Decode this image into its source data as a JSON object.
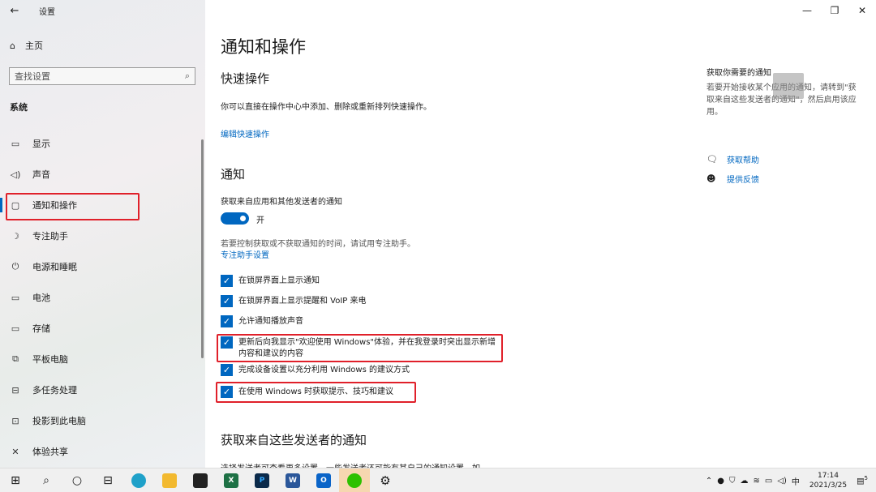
{
  "app": {
    "title": "设置",
    "back_icon": "back-arrow-icon"
  },
  "window_controls": {
    "minimize": "—",
    "maximize": "❐",
    "close": "✕"
  },
  "sidebar": {
    "home_label": "主页",
    "search_placeholder": "查找设置",
    "section": "系统",
    "items": [
      {
        "label": "显示",
        "icon": "display-icon"
      },
      {
        "label": "声音",
        "icon": "speaker-icon"
      },
      {
        "label": "通知和操作",
        "icon": "notification-icon",
        "active": true
      },
      {
        "label": "专注助手",
        "icon": "moon-icon"
      },
      {
        "label": "电源和睡眠",
        "icon": "power-icon"
      },
      {
        "label": "电池",
        "icon": "battery-icon"
      },
      {
        "label": "存储",
        "icon": "storage-icon"
      },
      {
        "label": "平板电脑",
        "icon": "tablet-icon"
      },
      {
        "label": "多任务处理",
        "icon": "multitask-icon"
      },
      {
        "label": "投影到此电脑",
        "icon": "project-icon"
      },
      {
        "label": "体验共享",
        "icon": "share-icon"
      }
    ]
  },
  "main": {
    "title": "通知和操作",
    "quick": {
      "heading": "快速操作",
      "desc": "你可以直接在操作中心中添加、删除或重新排列快速操作。",
      "link": "编辑快速操作"
    },
    "notify": {
      "heading": "通知",
      "toggle_label": "获取来自应用和其他发送者的通知",
      "toggle_state": "开",
      "focus_desc": "若要控制获取或不获取通知的时间，请试用专注助手。",
      "focus_link": "专注助手设置",
      "checkboxes": [
        "在锁屏界面上显示通知",
        "在锁屏界面上显示提醒和 VoIP 来电",
        "允许通知播放声音",
        "更新后向我显示\"欢迎使用 Windows\"体验，并在我登录时突出显示新增内容和建议的内容",
        "完成设备设置以充分利用 Windows 的建议方式",
        "在使用 Windows 时获取提示、技巧和建议"
      ]
    },
    "senders": {
      "heading": "获取来自这些发送者的通知",
      "partial": "选择发送者可查看更多设置。一些发送者还可能有其自己的通知设置。如"
    }
  },
  "right": {
    "title": "获取你需要的通知",
    "desc": "若要开始接收某个应用的通知，请转到\"获取来自这些发送者的通知\"，然后启用该应用。",
    "help": "获取帮助",
    "feedback": "提供反馈"
  },
  "taskbar": {
    "apps": [
      "X",
      "P",
      "W",
      "O"
    ],
    "ime": "中",
    "time": "17:14",
    "date": "2021/3/25",
    "badge": "5"
  }
}
